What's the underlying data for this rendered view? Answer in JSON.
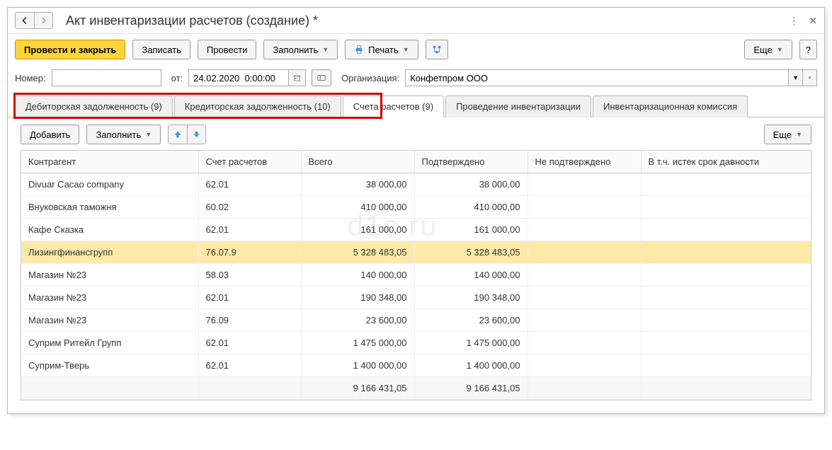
{
  "title": "Акт инвентаризации расчетов (создание) *",
  "toolbar": {
    "post_close": "Провести и закрыть",
    "write": "Записать",
    "post": "Провести",
    "fill": "Заполнить",
    "print": "Печать",
    "more": "Еще"
  },
  "form": {
    "number_label": "Номер:",
    "number_value": "",
    "from_label": "от:",
    "date_value": "24.02.2020  0:00:00",
    "org_label": "Организация:",
    "org_value": "Конфетпром ООО"
  },
  "tabs": [
    "Дебиторская задолженность (9)",
    "Кредиторская задолженность (10)",
    "Счета расчетов (9)",
    "Проведение инвентаризации",
    "Инвентаризационная комиссия"
  ],
  "sub_toolbar": {
    "add": "Добавить",
    "fill": "Заполнить",
    "more": "Еще"
  },
  "columns": {
    "counterparty": "Контрагент",
    "account": "Счет расчетов",
    "total": "Всего",
    "confirmed": "Подтверждено",
    "unconfirmed": "Не подтверждено",
    "expired": "В т.ч. истек срок давности"
  },
  "rows": [
    {
      "c": "Divuar Cacao company",
      "a": "62.01",
      "t": "38 000,00",
      "cf": "38 000,00"
    },
    {
      "c": "Внуковская таможня",
      "a": "60.02",
      "t": "410 000,00",
      "cf": "410 000,00"
    },
    {
      "c": "Кафе Сказка",
      "a": "62.01",
      "t": "161 000,00",
      "cf": "161 000,00"
    },
    {
      "c": "Лизингфинансгрупп",
      "a": "76.07.9",
      "t": "5 328 483,05",
      "cf": "5 328 483,05",
      "sel": true
    },
    {
      "c": "Магазин №23",
      "a": "58.03",
      "t": "140 000,00",
      "cf": "140 000,00"
    },
    {
      "c": "Магазин №23",
      "a": "62.01",
      "t": "190 348,00",
      "cf": "190 348,00"
    },
    {
      "c": "Магазин №23",
      "a": "76.09",
      "t": "23 600,00",
      "cf": "23 600,00"
    },
    {
      "c": "Суприм Ритейл Групп",
      "a": "62.01",
      "t": "1 475 000,00",
      "cf": "1 475 000,00"
    },
    {
      "c": "Суприм-Тверь",
      "a": "62.01",
      "t": "1 400 000,00",
      "cf": "1 400 000,00"
    }
  ],
  "totals": {
    "t": "9 166 431,05",
    "cf": "9 166 431,05"
  },
  "watermark": "d1c.ru"
}
